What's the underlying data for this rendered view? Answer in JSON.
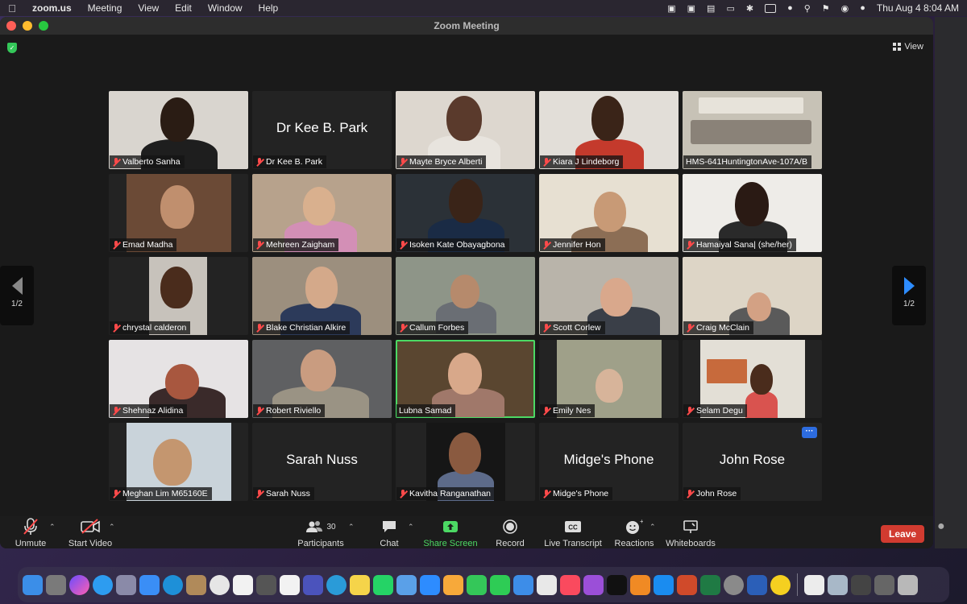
{
  "menubar": {
    "app": "zoom.us",
    "items": [
      "Meeting",
      "View",
      "Edit",
      "Window",
      "Help"
    ],
    "datetime": "Thu Aug 4  8:04 AM"
  },
  "window": {
    "title": "Zoom Meeting"
  },
  "view_label": "View",
  "pagination": {
    "prev": "1/2",
    "next": "1/2"
  },
  "participants_grid": [
    {
      "name": "Valberto Sanha"
    },
    {
      "name": "Dr Kee B. Park",
      "big_name": "Dr Kee B. Park"
    },
    {
      "name": "Mayte Bryce Alberti"
    },
    {
      "name": "Kiara J Lindeborg"
    },
    {
      "name": "HMS-641HuntingtonAve-107A/B"
    },
    {
      "name": "Emad Madha"
    },
    {
      "name": "Mehreen Zaigham"
    },
    {
      "name": "Isoken Kate Obayagbona"
    },
    {
      "name": "Jennifer Hon"
    },
    {
      "name": "Hamaiyal Sana| (she/her)"
    },
    {
      "name": "chrystal calderon"
    },
    {
      "name": "Blake Christian Alkire"
    },
    {
      "name": "Callum Forbes"
    },
    {
      "name": "Scott Corlew"
    },
    {
      "name": "Craig McClain"
    },
    {
      "name": "Shehnaz Alidina"
    },
    {
      "name": "Robert Riviello"
    },
    {
      "name": "Lubna Samad"
    },
    {
      "name": "Emily Nes"
    },
    {
      "name": "Selam Degu"
    },
    {
      "name": "Meghan Lim M65160E"
    },
    {
      "name": "Sarah Nuss",
      "big_name": "Sarah Nuss"
    },
    {
      "name": "Kavitha Ranganathan"
    },
    {
      "name": "Midge's Phone",
      "big_name": "Midge's Phone"
    },
    {
      "name": "John Rose",
      "big_name": "John Rose"
    }
  ],
  "toolbar": {
    "unmute": "Unmute",
    "start_video": "Start Video",
    "participants": "Participants",
    "participants_count": "30",
    "chat": "Chat",
    "share_screen": "Share Screen",
    "record": "Record",
    "live_transcript": "Live Transcript",
    "reactions": "Reactions",
    "whiteboards": "Whiteboards",
    "leave": "Leave"
  },
  "colors": {
    "share_green": "#4cd964",
    "leave_red": "#d13b30",
    "speaking_border": "#4cd964",
    "muted_red": "#ff4a4a"
  }
}
